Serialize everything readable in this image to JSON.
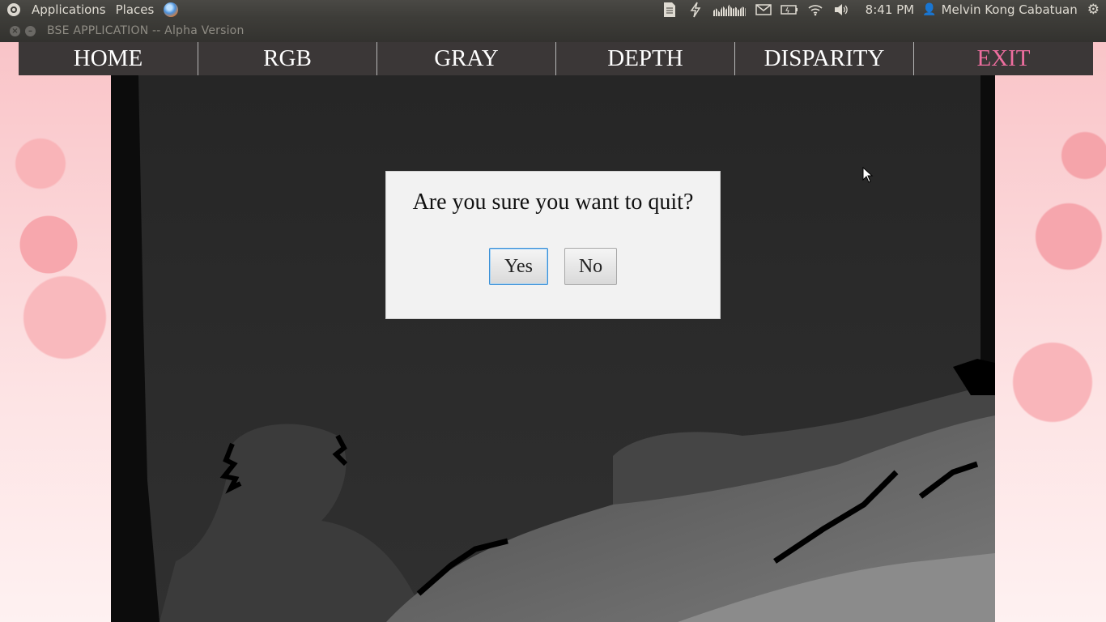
{
  "top_panel": {
    "menu": [
      "Applications",
      "Places"
    ],
    "clock": "8:41 PM",
    "user": "Melvin Kong Cabatuan",
    "icons": [
      "ubuntu-logo-icon",
      "browser-icon",
      "document-icon",
      "power-icon",
      "system-monitor-icon",
      "mail-icon",
      "battery-icon",
      "wifi-icon",
      "volume-icon",
      "user-icon",
      "gear-icon"
    ]
  },
  "window": {
    "title": "BSE APPLICATION -- Alpha Version"
  },
  "nav": {
    "items": [
      {
        "label": "HOME"
      },
      {
        "label": "RGB"
      },
      {
        "label": "GRAY"
      },
      {
        "label": "DEPTH"
      },
      {
        "label": "DISPARITY"
      },
      {
        "label": "EXIT"
      }
    ],
    "active_color": "#ee6e9f"
  },
  "dialog": {
    "message": "Are you sure you want to quit?",
    "yes_label": "Yes",
    "no_label": "No"
  }
}
